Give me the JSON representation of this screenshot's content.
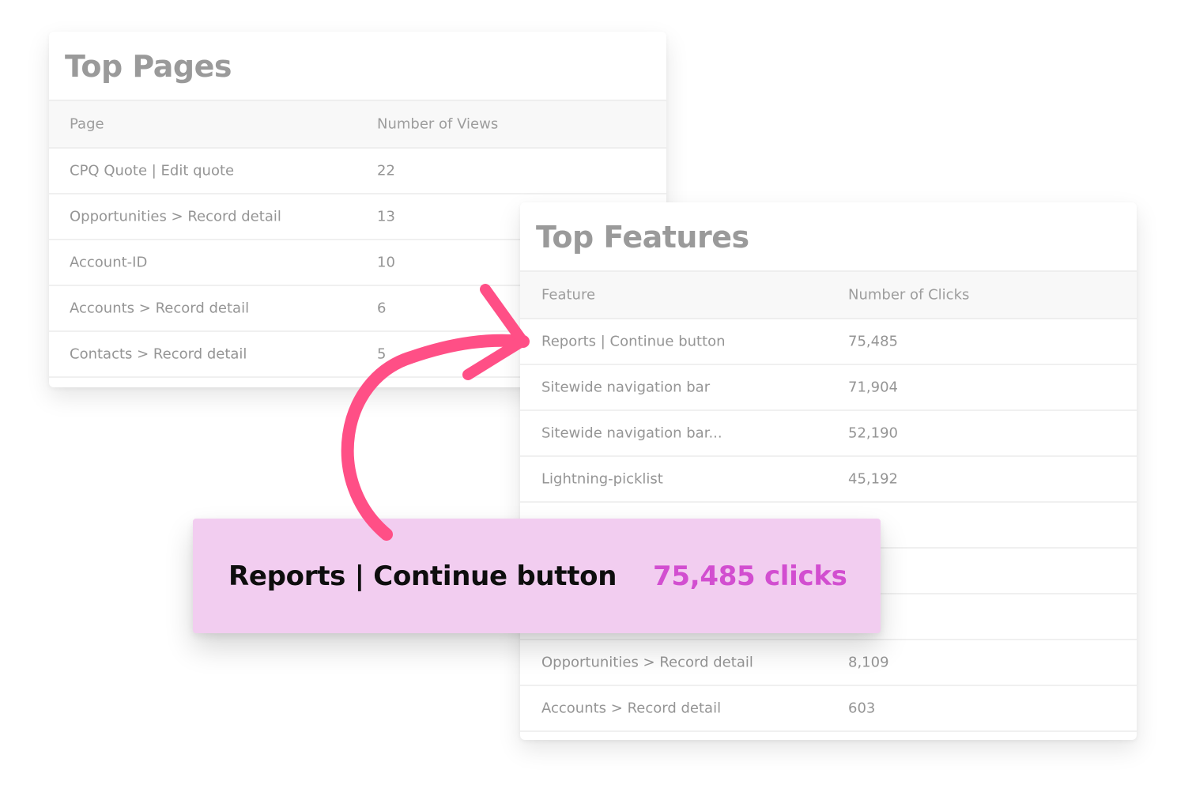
{
  "top_pages": {
    "title": "Top Pages",
    "columns": [
      "Page",
      "Number of Views"
    ],
    "rows": [
      [
        "CPQ Quote | Edit quote",
        "22"
      ],
      [
        "Opportunities > Record detail",
        "13"
      ],
      [
        "Account-ID",
        "10"
      ],
      [
        "Accounts > Record detail",
        "6"
      ],
      [
        "Contacts > Record detail",
        "5"
      ]
    ]
  },
  "top_features": {
    "title": "Top Features",
    "columns": [
      "Feature",
      "Number of Clicks"
    ],
    "rows": [
      [
        "Reports | Continue button",
        "75,485"
      ],
      [
        "Sitewide navigation bar",
        "71,904"
      ],
      [
        "Sitewide navigation bar...",
        "52,190"
      ],
      [
        "Lightning-picklist",
        "45,192"
      ],
      [
        "",
        ""
      ],
      [
        "",
        ""
      ],
      [
        "",
        ""
      ],
      [
        "Opportunities > Record detail",
        "8,109"
      ],
      [
        "Accounts > Record detail",
        "603"
      ]
    ]
  },
  "callout": {
    "feature": "Reports | Continue button",
    "count": "75,485 clicks"
  },
  "colors": {
    "callout_background": "#f2cdf0",
    "callout_accent": "#d24ed0",
    "arrow": "#ff4f86"
  }
}
